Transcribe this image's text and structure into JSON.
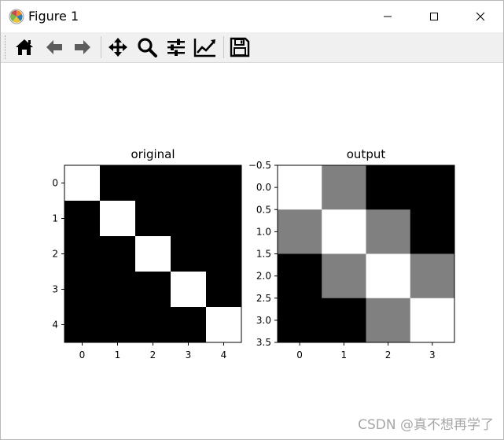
{
  "window": {
    "title": "Figure 1"
  },
  "toolbar": {
    "buttons": [
      {
        "name": "home",
        "icon": "home-icon"
      },
      {
        "name": "back",
        "icon": "arrow-left-icon"
      },
      {
        "name": "forward",
        "icon": "arrow-right-icon"
      },
      {
        "name": "pan",
        "icon": "move-icon"
      },
      {
        "name": "zoom",
        "icon": "magnifier-icon"
      },
      {
        "name": "subplots",
        "icon": "sliders-icon"
      },
      {
        "name": "customize",
        "icon": "line-chart-icon"
      },
      {
        "name": "save",
        "icon": "floppy-disk-icon"
      }
    ]
  },
  "chart_data": [
    {
      "type": "heatmap",
      "title": "original",
      "xticks": [
        "0",
        "1",
        "2",
        "3",
        "4"
      ],
      "yticks": [
        "0",
        "1",
        "2",
        "3",
        "4"
      ],
      "matrix": [
        [
          1,
          0,
          0,
          0,
          0
        ],
        [
          0,
          1,
          0,
          0,
          0
        ],
        [
          0,
          0,
          1,
          0,
          0
        ],
        [
          0,
          0,
          0,
          1,
          0
        ],
        [
          0,
          0,
          0,
          0,
          1
        ]
      ],
      "colormap": "gray"
    },
    {
      "type": "heatmap",
      "title": "output",
      "xticks": [
        "0",
        "1",
        "2",
        "3"
      ],
      "yticks": [
        "−0.5",
        "0.0",
        "0.5",
        "1.0",
        "1.5",
        "2.0",
        "2.5",
        "3.0",
        "3.5"
      ],
      "matrix": [
        [
          1,
          0.5,
          0,
          0
        ],
        [
          0.5,
          1,
          0.5,
          0
        ],
        [
          0,
          0.5,
          1,
          0.5
        ],
        [
          0,
          0,
          0.5,
          1
        ]
      ],
      "colormap": "gray"
    }
  ],
  "watermark": "CSDN @真不想再学了"
}
